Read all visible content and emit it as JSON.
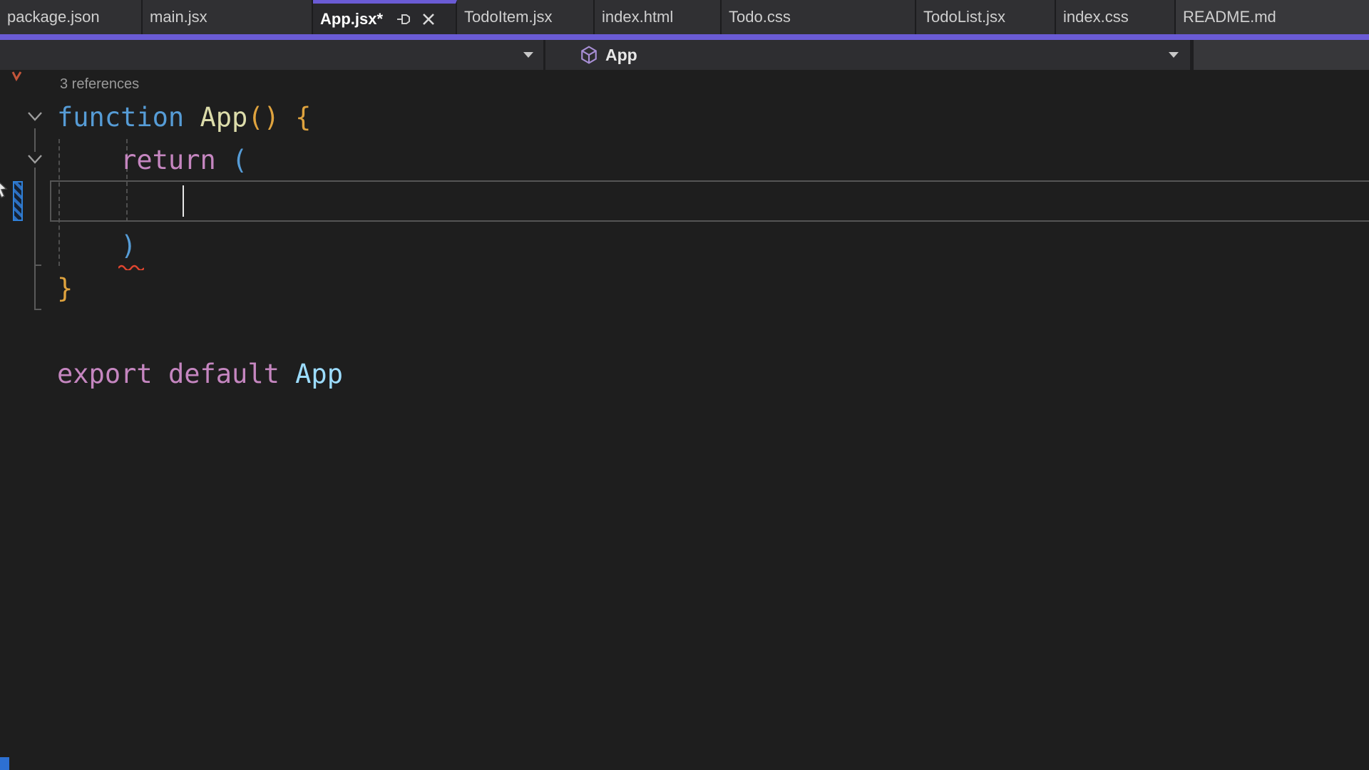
{
  "tabs": [
    {
      "label": "package.json",
      "active": false
    },
    {
      "label": "main.jsx",
      "active": false
    },
    {
      "label": "App.jsx*",
      "active": true,
      "modified": true
    },
    {
      "label": "TodoItem.jsx",
      "active": false
    },
    {
      "label": "index.html",
      "active": false
    },
    {
      "label": "Todo.css",
      "active": false
    },
    {
      "label": "TodoList.jsx",
      "active": false
    },
    {
      "label": "index.css",
      "active": false
    },
    {
      "label": "README.md",
      "active": false
    }
  ],
  "navbar": {
    "scope_dropdown_value": "",
    "member_dropdown_value": "App",
    "member_icon": "class-cube-icon"
  },
  "editor": {
    "codelens": "3 references",
    "lines": [
      {
        "tokens": [
          {
            "t": "function "
          },
          {
            "t": "App"
          },
          {
            "t": "()"
          },
          {
            "t": " {"
          }
        ]
      },
      {
        "tokens": [
          {
            "t": "    "
          },
          {
            "t": "return"
          },
          {
            "t": " "
          },
          {
            "t": "("
          }
        ]
      },
      {
        "tokens": []
      },
      {
        "tokens": [
          {
            "t": "    "
          },
          {
            "t": ")"
          }
        ]
      },
      {
        "tokens": [
          {
            "t": "}"
          }
        ]
      },
      {
        "tokens": []
      },
      {
        "tokens": [
          {
            "t": "export"
          },
          {
            "t": " "
          },
          {
            "t": "default"
          },
          {
            "t": " "
          },
          {
            "t": "App"
          }
        ]
      }
    ]
  },
  "theme": {
    "accent_purple": "#6A5BD5",
    "editor_background": "#1E1E1E",
    "tab_background": "#303033",
    "navbar_background": "#2E2E31",
    "keyword_blue": "#569CD6",
    "function_yellow": "#DCDCAA",
    "bracket_gold": "#DFA33E",
    "control_pink": "#C586C0",
    "variable_blue": "#9CDCFE",
    "error_red": "#E0452F",
    "selection_margin_blue": "#2F80D8"
  }
}
